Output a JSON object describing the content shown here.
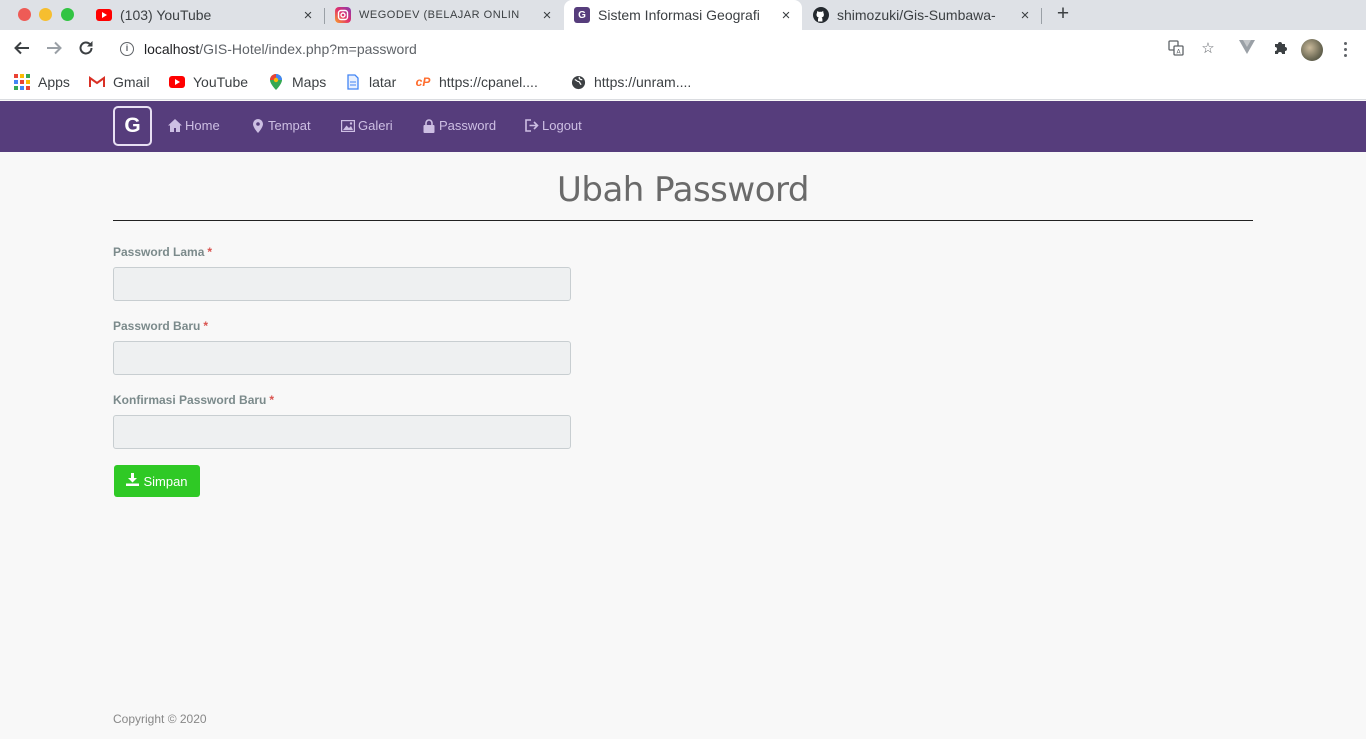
{
  "browser": {
    "tabs": [
      {
        "title": "(103) YouTube",
        "icon": "youtube-icon",
        "close": "×"
      },
      {
        "title": "WEGODEV (BELAJAR ONLIN",
        "icon": "instagram-icon",
        "close": "×"
      },
      {
        "title": "Sistem Informasi Geografi",
        "icon": "gis-favicon-icon",
        "close": "×"
      },
      {
        "title": "shimozuki/Gis-Sumbawa-",
        "icon": "github-icon",
        "close": "×"
      }
    ],
    "new_tab": "+",
    "url_host": "localhost",
    "url_path": "/GIS-Hotel/index.php?m=password",
    "bookmarks": [
      {
        "label": "Apps",
        "icon": "apps-grid-icon"
      },
      {
        "label": "Gmail",
        "icon": "gmail-icon"
      },
      {
        "label": "YouTube",
        "icon": "youtube-icon"
      },
      {
        "label": "Maps",
        "icon": "maps-pin-icon"
      },
      {
        "label": "latar",
        "icon": "document-icon"
      },
      {
        "label": "https://cpanel....",
        "icon": "cpanel-icon"
      },
      {
        "label": "https://unram....",
        "icon": "globe-icon"
      }
    ]
  },
  "navbar": {
    "brand": "G",
    "items": [
      {
        "label": "Home",
        "icon": "home-icon"
      },
      {
        "label": "Tempat",
        "icon": "map-marker-icon"
      },
      {
        "label": "Galeri",
        "icon": "picture-icon"
      },
      {
        "label": "Password",
        "icon": "lock-icon"
      },
      {
        "label": "Logout",
        "icon": "logout-icon"
      }
    ]
  },
  "page": {
    "title": "Ubah Password"
  },
  "form": {
    "required_mark": "*",
    "fields": [
      {
        "label": "Password Lama",
        "value": ""
      },
      {
        "label": "Password Baru",
        "value": ""
      },
      {
        "label": "Konfirmasi Password Baru",
        "value": ""
      }
    ],
    "submit_label": "Simpan"
  },
  "footer": {
    "copyright": "Copyright © 2020"
  },
  "colors": {
    "navbar": "#563d7c",
    "submit": "#2fc925",
    "required": "#d9534f"
  }
}
